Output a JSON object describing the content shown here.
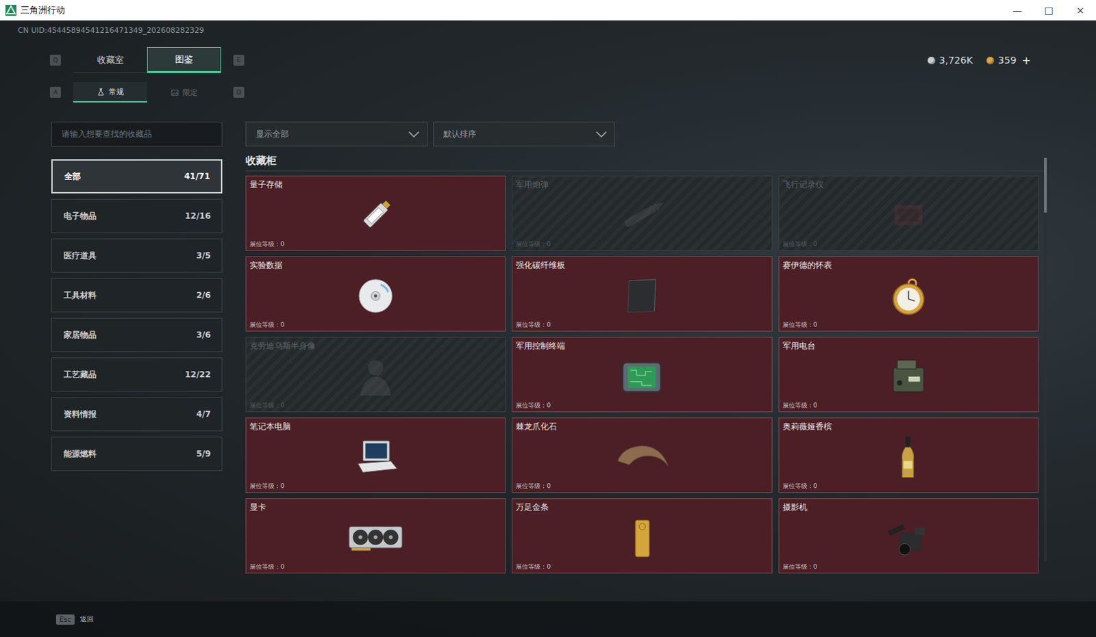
{
  "window": {
    "title": "三角洲行动",
    "controls": [
      "—",
      "□",
      "×"
    ]
  },
  "uid": "CN UID:45445894541216471349_202608282329",
  "currency": [
    {
      "value": "3,726K",
      "color": "#c9ccd0"
    },
    {
      "value": "359",
      "color": "#d9a441"
    }
  ],
  "currency_add": "+",
  "tabs": {
    "prev_key": "Q",
    "next_key": "E",
    "items": [
      {
        "label": "收藏室",
        "selected": false
      },
      {
        "label": "图鉴",
        "selected": true
      }
    ]
  },
  "subtabs": {
    "prev_key": "A",
    "next_key": "D",
    "items": [
      {
        "label": "常规",
        "selected": true
      },
      {
        "label": "限定",
        "selected": false
      }
    ]
  },
  "search": {
    "placeholder": "请输入想要查找的收藏品"
  },
  "filters": [
    {
      "label": "显示全部"
    },
    {
      "label": "默认排序"
    }
  ],
  "sidebar": {
    "items": [
      {
        "label": "全部",
        "count": "41/71",
        "selected": true
      },
      {
        "label": "电子物品",
        "count": "12/16",
        "selected": false
      },
      {
        "label": "医疗道具",
        "count": "3/5",
        "selected": false
      },
      {
        "label": "工具材料",
        "count": "2/6",
        "selected": false
      },
      {
        "label": "家居物品",
        "count": "3/6",
        "selected": false
      },
      {
        "label": "工艺藏品",
        "count": "12/22",
        "selected": false
      },
      {
        "label": "资料情报",
        "count": "4/7",
        "selected": false
      },
      {
        "label": "能源燃料",
        "count": "5/9",
        "selected": false
      }
    ]
  },
  "section_title": "收藏柜",
  "items": [
    {
      "name": "量子存储",
      "collected": true,
      "footer": "展位等级：0"
    },
    {
      "name": "军用炮弹",
      "collected": false,
      "footer": "展位等级：0"
    },
    {
      "name": "飞行记录仪",
      "collected": false,
      "footer": "展位等级：0"
    },
    {
      "name": "实验数据",
      "collected": true,
      "footer": "展位等级：0"
    },
    {
      "name": "强化碳纤维板",
      "collected": true,
      "footer": "展位等级：0"
    },
    {
      "name": "赛伊德的怀表",
      "collected": true,
      "footer": "展位等级：0"
    },
    {
      "name": "克劳迪乌斯半身像",
      "collected": false,
      "footer": "展位等级：0"
    },
    {
      "name": "军用控制终端",
      "collected": true,
      "footer": "展位等级：0"
    },
    {
      "name": "军用电台",
      "collected": true,
      "footer": "展位等级：0"
    },
    {
      "name": "笔记本电脑",
      "collected": true,
      "footer": "展位等级：0"
    },
    {
      "name": "棘龙爪化石",
      "collected": true,
      "footer": "展位等级：0"
    },
    {
      "name": "奥莉薇娅香槟",
      "collected": true,
      "footer": "展位等级：0"
    },
    {
      "name": "显卡",
      "collected": true,
      "footer": "展位等级：0"
    },
    {
      "name": "万足金条",
      "collected": true,
      "footer": "展位等级：0"
    },
    {
      "name": "摄影机",
      "collected": true,
      "footer": "展位等级：0"
    }
  ],
  "footer": {
    "key": "Esc",
    "label": "返回"
  }
}
